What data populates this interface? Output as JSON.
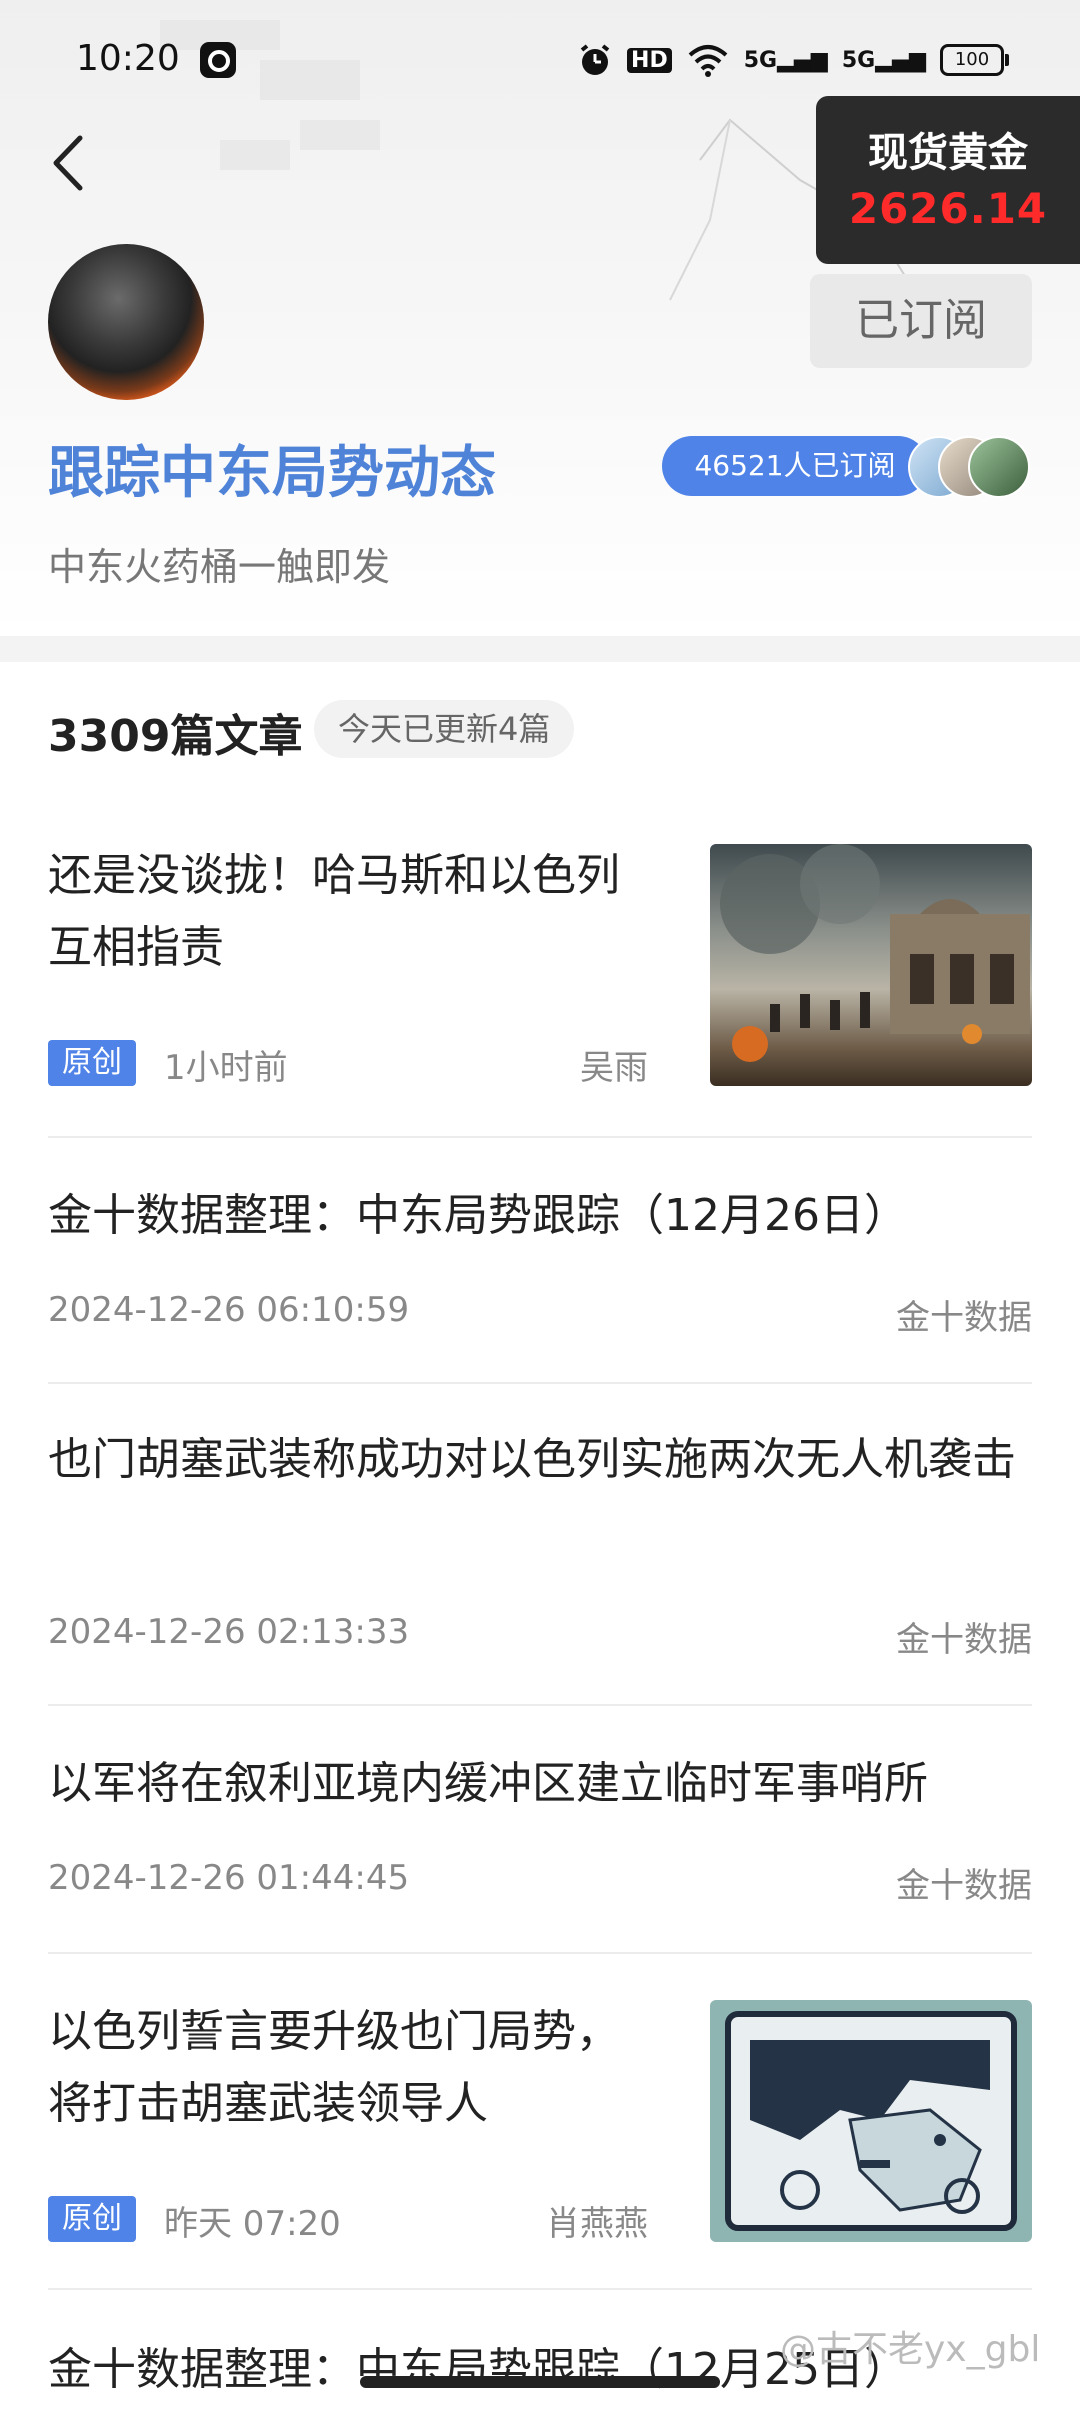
{
  "status_bar": {
    "time": "10:20",
    "icons": [
      "alarm-icon",
      "hd-icon",
      "wifi-icon",
      "5g-signal-icon",
      "5g-signal-icon",
      "battery-icon"
    ],
    "hd": "HD",
    "net1": "5G",
    "net2": "5G",
    "battery": "100"
  },
  "gold_widget": {
    "name": "现货黄金",
    "price": "2626.14"
  },
  "header": {
    "subscribe_button": "已订阅",
    "title": "跟踪中东局势动态",
    "subscribers": "46521人已订阅",
    "description": "中东火药桶一触即发"
  },
  "list_header": {
    "count": "3309篇文章",
    "today": "今天已更新4篇"
  },
  "articles": [
    {
      "title": "还是没谈拢！哈马斯和以色列互相指责",
      "tag": "原创",
      "time": "1小时前",
      "source": "吴雨"
    },
    {
      "title": "金十数据整理：中东局势跟踪（12月26日）",
      "time": "2024-12-26 06:10:59",
      "source": "金十数据"
    },
    {
      "title": "也门胡塞武装称成功对以色列实施两次无人机袭击",
      "time": "2024-12-26 02:13:33",
      "source": "金十数据"
    },
    {
      "title": "以军将在叙利亚境内缓冲区建立临时军事哨所",
      "time": "2024-12-26 01:44:45",
      "source": "金十数据"
    },
    {
      "title": "以色列誓言要升级也门局势，将打击胡塞武装领导人",
      "tag": "原创",
      "time": "昨天 07:20",
      "source": "肖燕燕"
    },
    {
      "title": "金十数据整理：中东局势跟踪（12月25日）"
    }
  ],
  "watermark": "@古不老yx_gbl",
  "colors": {
    "accent": "#4f83e8",
    "title_blue": "#4f83d8",
    "price_red": "#ff2a2a"
  }
}
